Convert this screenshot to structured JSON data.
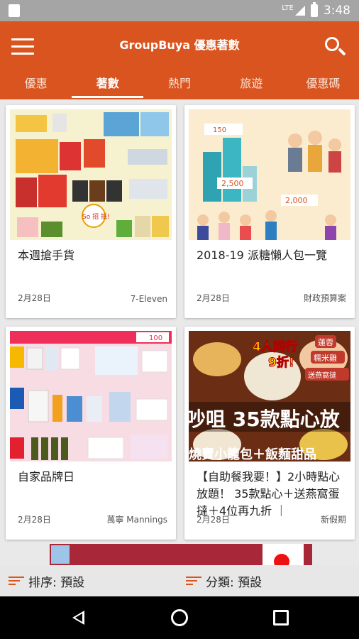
{
  "status": {
    "network": "LTE",
    "time": "3:48"
  },
  "appbar": {
    "title": "GroupBuya 優惠著數"
  },
  "tabs": [
    {
      "label": "優惠",
      "active": false
    },
    {
      "label": "著數",
      "active": true
    },
    {
      "label": "熱門",
      "active": false
    },
    {
      "label": "旅遊",
      "active": false
    },
    {
      "label": "優惠碼",
      "active": false
    }
  ],
  "cards": [
    {
      "title": "本週搶手貨",
      "date": "2月28日",
      "source": "7-Eleven"
    },
    {
      "title": "2018-19 派糖懶人包一覽",
      "date": "2月28日",
      "source": "財政預算案"
    },
    {
      "title": "自家品牌日",
      "date": "2月28日",
      "source": "萬寧 Mannings"
    },
    {
      "title": "【自助餐我要！】2小時點心放題！ 35款點心＋送燕窩蛋撻＋4位再九折 ｜",
      "date": "2月28日",
      "source": "新假期"
    }
  ],
  "thumbs": {
    "c1": {
      "badge": "So 招 抵!"
    },
    "c2": {
      "num1": "150",
      "num2": "2,500",
      "num3": "2,000"
    },
    "c3": {
      "tag": "100"
    },
    "c4": {
      "line1": "4人同行",
      "line2": "9折!",
      "tag1": "蓮蓉",
      "tag2": "糯米雞",
      "tag3": "送燕窩撻",
      "headline": "吵咀 35款點心放",
      "subline": "燒賣小籠包＋飯麵甜品"
    }
  },
  "sortbar": {
    "sort_label": "排序: 預設",
    "category_label": "分類: 預設"
  },
  "colors": {
    "primary": "#d9541e",
    "status_bar": "#a5a5a5"
  }
}
